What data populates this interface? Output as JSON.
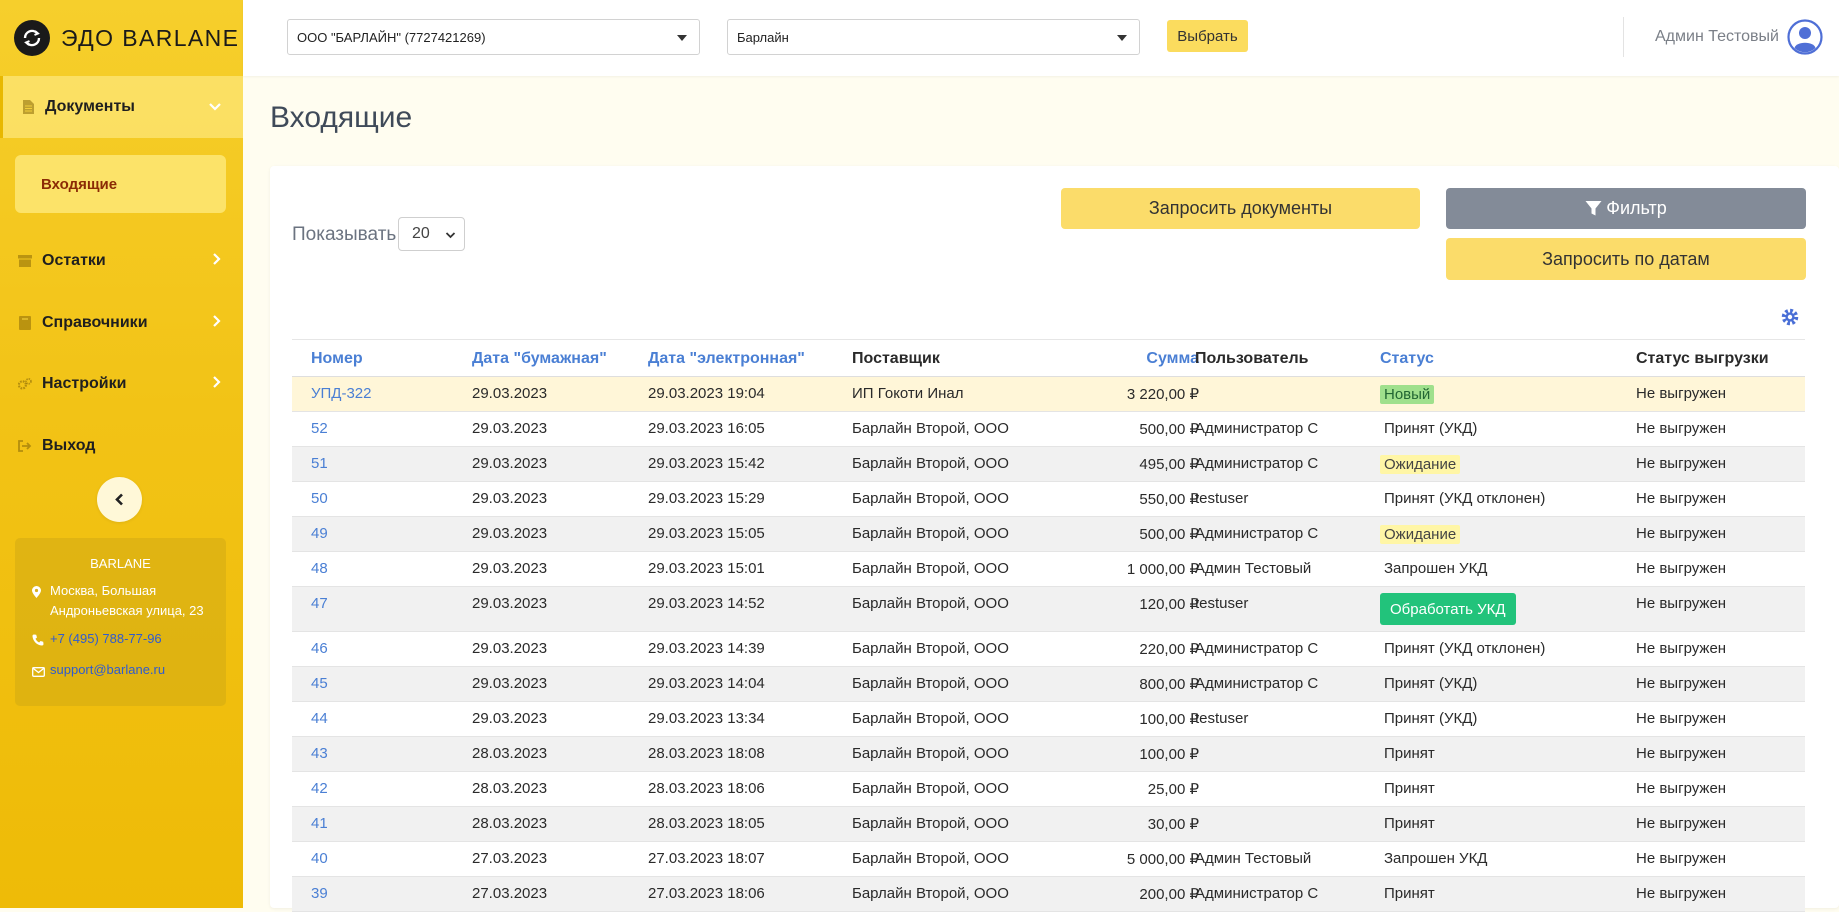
{
  "brand": {
    "name": "ЭДО BARLANE"
  },
  "sidebar": {
    "documents": "Документы",
    "incoming": "Входящие",
    "items": [
      {
        "label": "Остатки",
        "icon": "box-icon"
      },
      {
        "label": "Справочники",
        "icon": "book-icon"
      },
      {
        "label": "Настройки",
        "icon": "gears-icon"
      },
      {
        "label": "Выход",
        "icon": "logout-icon"
      }
    ],
    "contact": {
      "title": "BARLANE",
      "address": "Москва, Большая Андроньевская улица, 23",
      "phone": "+7 (495) 788-77-96",
      "email": "support@barlane.ru"
    }
  },
  "topbar": {
    "org_select": "ООО \"БАРЛАЙН\" (7727421269)",
    "store_select": "Барлайн",
    "choose_label": "Выбрать",
    "user_name": "Админ Тестовый"
  },
  "page": {
    "title": "Входящие",
    "show_label": "Показывать",
    "page_size": "20",
    "request_docs": "Запросить документы",
    "filter": "Фильтр",
    "request_dates": "Запросить по датам"
  },
  "table": {
    "headers": {
      "number": "Номер",
      "paper_date": "Дата \"бумажная\"",
      "e_date": "Дата \"электронная\"",
      "supplier": "Поставщик",
      "sum": "Сумма",
      "user": "Пользователь",
      "status": "Статус",
      "export": "Статус выгрузки"
    },
    "rows": [
      {
        "num": "УПД-322",
        "paper": "29.03.2023",
        "edate": "29.03.2023 19:04",
        "supplier": "ИП Гокоти Инал",
        "sum": "3 220,00 ₽",
        "user": "",
        "status": "Новый",
        "export": "Не выгружен"
      },
      {
        "num": "52",
        "paper": "29.03.2023",
        "edate": "29.03.2023 16:05",
        "supplier": "Барлайн Второй, ООО",
        "sum": "500,00 ₽",
        "user": "Администратор С",
        "status": "Принят (УКД)",
        "export": "Не выгружен"
      },
      {
        "num": "51",
        "paper": "29.03.2023",
        "edate": "29.03.2023 15:42",
        "supplier": "Барлайн Второй, ООО",
        "sum": "495,00 ₽",
        "user": "Администратор С",
        "status": "Ожидание",
        "export": "Не выгружен"
      },
      {
        "num": "50",
        "paper": "29.03.2023",
        "edate": "29.03.2023 15:29",
        "supplier": "Барлайн Второй, ООО",
        "sum": "550,00 ₽",
        "user": "testuser",
        "status": "Принят (УКД отклонен)",
        "export": "Не выгружен"
      },
      {
        "num": "49",
        "paper": "29.03.2023",
        "edate": "29.03.2023 15:05",
        "supplier": "Барлайн Второй, ООО",
        "sum": "500,00 ₽",
        "user": "Администратор С",
        "status": "Ожидание",
        "export": "Не выгружен"
      },
      {
        "num": "48",
        "paper": "29.03.2023",
        "edate": "29.03.2023 15:01",
        "supplier": "Барлайн Второй, ООО",
        "sum": "1 000,00 ₽",
        "user": "Админ Тестовый",
        "status": "Запрошен УКД",
        "export": "Не выгружен"
      },
      {
        "num": "47",
        "paper": "29.03.2023",
        "edate": "29.03.2023 14:52",
        "supplier": "Барлайн Второй, ООО",
        "sum": "120,00 ₽",
        "user": "testuser",
        "status": "Обработать УКД",
        "export": "Не выгружен"
      },
      {
        "num": "46",
        "paper": "29.03.2023",
        "edate": "29.03.2023 14:39",
        "supplier": "Барлайн Второй, ООО",
        "sum": "220,00 ₽",
        "user": "Администратор С",
        "status": "Принят (УКД отклонен)",
        "export": "Не выгружен"
      },
      {
        "num": "45",
        "paper": "29.03.2023",
        "edate": "29.03.2023 14:04",
        "supplier": "Барлайн Второй, ООО",
        "sum": "800,00 ₽",
        "user": "Администратор С",
        "status": "Принят (УКД)",
        "export": "Не выгружен"
      },
      {
        "num": "44",
        "paper": "29.03.2023",
        "edate": "29.03.2023 13:34",
        "supplier": "Барлайн Второй, ООО",
        "sum": "100,00 ₽",
        "user": "testuser",
        "status": "Принят (УКД)",
        "export": "Не выгружен"
      },
      {
        "num": "43",
        "paper": "28.03.2023",
        "edate": "28.03.2023 18:08",
        "supplier": "Барлайн Второй, ООО",
        "sum": "100,00 ₽",
        "user": "",
        "status": "Принят",
        "export": "Не выгружен"
      },
      {
        "num": "42",
        "paper": "28.03.2023",
        "edate": "28.03.2023 18:06",
        "supplier": "Барлайн Второй, ООО",
        "sum": "25,00 ₽",
        "user": "",
        "status": "Принят",
        "export": "Не выгружен"
      },
      {
        "num": "41",
        "paper": "28.03.2023",
        "edate": "28.03.2023 18:05",
        "supplier": "Барлайн Второй, ООО",
        "sum": "30,00 ₽",
        "user": "",
        "status": "Принят",
        "export": "Не выгружен"
      },
      {
        "num": "40",
        "paper": "27.03.2023",
        "edate": "27.03.2023 18:07",
        "supplier": "Барлайн Второй, ООО",
        "sum": "5 000,00 ₽",
        "user": "Админ Тестовый",
        "status": "Запрошен УКД",
        "export": "Не выгружен"
      },
      {
        "num": "39",
        "paper": "27.03.2023",
        "edate": "27.03.2023 18:06",
        "supplier": "Барлайн Второй, ООО",
        "sum": "200,00 ₽",
        "user": "Администратор С",
        "status": "Принят",
        "export": "Не выгружен"
      }
    ]
  },
  "colors": {
    "sidebar": "#f2c316",
    "accent_yellow": "#fbdc6a",
    "link_blue": "#4a7fd4",
    "badge_green": "#9fe08c",
    "badge_yellow": "#fff6a6",
    "process_button": "#22c37b",
    "filter_button": "#838b98"
  }
}
